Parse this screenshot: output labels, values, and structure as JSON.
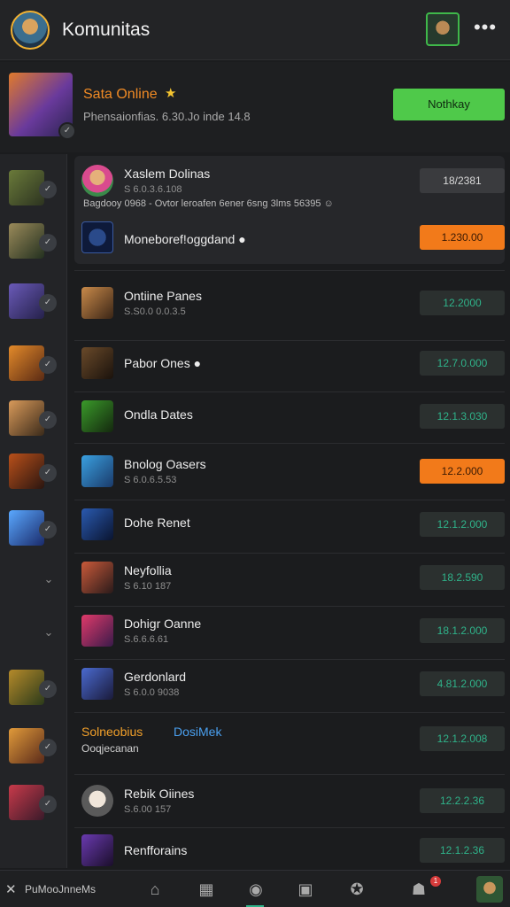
{
  "header": {
    "title": "Komunitas",
    "more_label": "•••"
  },
  "featured": {
    "name": "Sata Online",
    "star": "★",
    "subtitle": "Phensaionfias. 6.30.Jo inde 14.8",
    "button": "Nothkay"
  },
  "group": {
    "title": "Xaslem Dolinas",
    "star": "★",
    "meta": "S 6.0.3.6.108",
    "price": "18/2381",
    "description": "Bagdooy 0968 - Ovtor leroafen 6ener 6sng 3lms 56395 ☺",
    "sub_title": "Moneboref!oggdand ●",
    "sub_price": "1.230.00"
  },
  "rows": [
    {
      "title": "Ontiine Panes",
      "meta": "S.S0.0 0.0.3.5",
      "price": "12.2000"
    },
    {
      "title": "Pabor Ones ●",
      "meta": "",
      "price": "12.7.0.000"
    },
    {
      "title": "Ondla Dates",
      "meta": "",
      "price": "12.1.3.030"
    },
    {
      "title": "Bnolog Oasers",
      "meta": "S 6.0.6.5.53",
      "price": "12.2.000"
    },
    {
      "title": "Dohe Renet",
      "meta": "",
      "price": "12.1.2.000"
    },
    {
      "title": "Neyfollia",
      "meta": "S 6.10 187",
      "price": "18.2.590"
    },
    {
      "title": "Dohigr Oanne",
      "meta": "S.6.6.6.61",
      "price": "18.1.2.000"
    },
    {
      "title": "Gerdonlard",
      "meta": "S 6.0.0 9038",
      "price": "4.81.2.000"
    },
    {
      "title": "Solneobius",
      "title2": "DosiMek",
      "meta": "Ooqjecanan",
      "price": "12.1.2.008"
    },
    {
      "title": "Rebik Oiines",
      "meta": "S.6.00 157",
      "price": "12.2.2.36"
    },
    {
      "title": "Renfforains",
      "meta": "",
      "price": "12.1.2.36"
    }
  ],
  "bottom_nav": {
    "close": "✕",
    "label": "PuMooJnneMs",
    "notif_count": "1"
  },
  "colors": {
    "accent_green": "#4fc94a",
    "accent_orange": "#f27a1a",
    "price_text": "#2fb38a"
  }
}
